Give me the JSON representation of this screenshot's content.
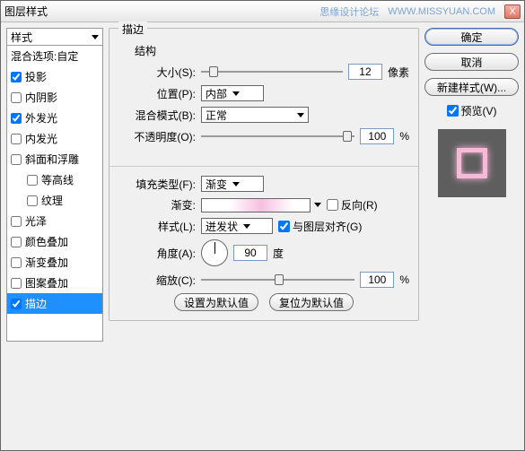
{
  "titlebar": {
    "title": "图层样式",
    "watermark1": "思缘设计论坛",
    "watermark2": "WWW.MISSYUAN.COM",
    "close": "X"
  },
  "left": {
    "header": "样式",
    "blend_options": "混合选项:自定",
    "items": [
      {
        "label": "投影",
        "checked": true
      },
      {
        "label": "内阴影",
        "checked": false
      },
      {
        "label": "外发光",
        "checked": true
      },
      {
        "label": "内发光",
        "checked": false
      },
      {
        "label": "斜面和浮雕",
        "checked": false
      },
      {
        "label": "等高线",
        "checked": false,
        "sub": true
      },
      {
        "label": "纹理",
        "checked": false,
        "sub": true
      },
      {
        "label": "光泽",
        "checked": false
      },
      {
        "label": "颜色叠加",
        "checked": false
      },
      {
        "label": "渐变叠加",
        "checked": false
      },
      {
        "label": "图案叠加",
        "checked": false
      },
      {
        "label": "描边",
        "checked": true,
        "selected": true
      }
    ]
  },
  "stroke": {
    "group_title": "描边",
    "structure_title": "结构",
    "size_label": "大小(S):",
    "size_value": "12",
    "size_unit": "像素",
    "position_label": "位置(P):",
    "position_value": "内部",
    "blend_label": "混合模式(B):",
    "blend_value": "正常",
    "opacity_label": "不透明度(O):",
    "opacity_value": "100",
    "opacity_unit": "%",
    "filltype_label": "填充类型(F):",
    "filltype_value": "渐变",
    "gradient_label": "渐变:",
    "reverse_label": "反向(R)",
    "style_label": "样式(L):",
    "style_value": "迸发状",
    "align_label": "与图层对齐(G)",
    "angle_label": "角度(A):",
    "angle_value": "90",
    "angle_unit": "度",
    "scale_label": "缩放(C):",
    "scale_value": "100",
    "scale_unit": "%",
    "btn_default": "设置为默认值",
    "btn_reset": "复位为默认值"
  },
  "right": {
    "ok": "确定",
    "cancel": "取消",
    "new_style": "新建样式(W)...",
    "preview": "预览(V)"
  }
}
